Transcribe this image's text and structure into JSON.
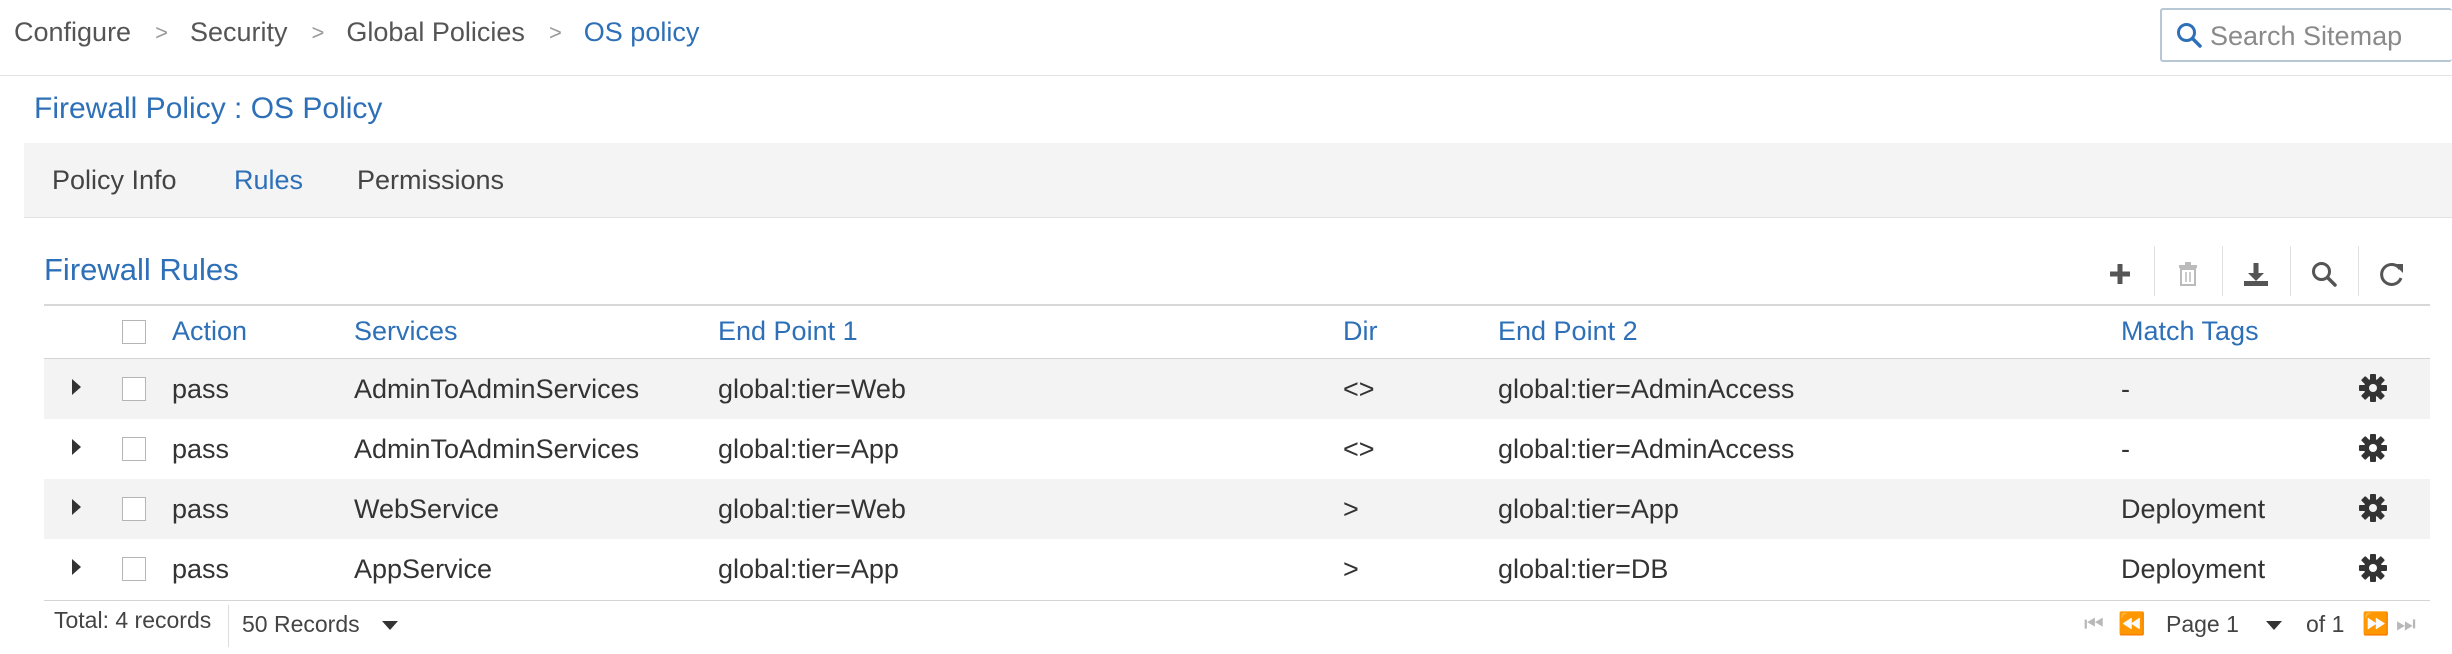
{
  "breadcrumb": {
    "items": [
      "Configure",
      "Security",
      "Global Policies",
      "OS policy"
    ]
  },
  "search": {
    "placeholder": "Search Sitemap"
  },
  "page": {
    "title": "Firewall Policy : OS Policy"
  },
  "tabs": [
    {
      "label": "Policy Info"
    },
    {
      "label": "Rules"
    },
    {
      "label": "Permissions"
    }
  ],
  "section": {
    "title": "Firewall Rules"
  },
  "toolbar": {
    "icons": [
      "plus-icon",
      "trash-icon",
      "download-icon",
      "search-icon",
      "refresh-icon"
    ]
  },
  "table": {
    "headers": {
      "action": "Action",
      "services": "Services",
      "endpoint1": "End Point 1",
      "dir": "Dir",
      "endpoint2": "End Point 2",
      "match_tags": "Match Tags"
    },
    "rows": [
      {
        "action": "pass",
        "services": "AdminToAdminServices",
        "endpoint1": "global:tier=Web",
        "dir": "<>",
        "endpoint2": "global:tier=AdminAccess",
        "match_tags": "-"
      },
      {
        "action": "pass",
        "services": "AdminToAdminServices",
        "endpoint1": "global:tier=App",
        "dir": "<>",
        "endpoint2": "global:tier=AdminAccess",
        "match_tags": "-"
      },
      {
        "action": "pass",
        "services": "WebService",
        "endpoint1": "global:tier=Web",
        "dir": ">",
        "endpoint2": "global:tier=App",
        "match_tags": "Deployment"
      },
      {
        "action": "pass",
        "services": "AppService",
        "endpoint1": "global:tier=App",
        "dir": ">",
        "endpoint2": "global:tier=DB",
        "match_tags": "Deployment"
      }
    ]
  },
  "footer": {
    "total": "Total: 4 records",
    "page_size": "50 Records",
    "page": "Page 1",
    "of": "of 1"
  },
  "colors": {
    "accent": "#2e70b8",
    "row_alt": "#f3f3f3"
  }
}
